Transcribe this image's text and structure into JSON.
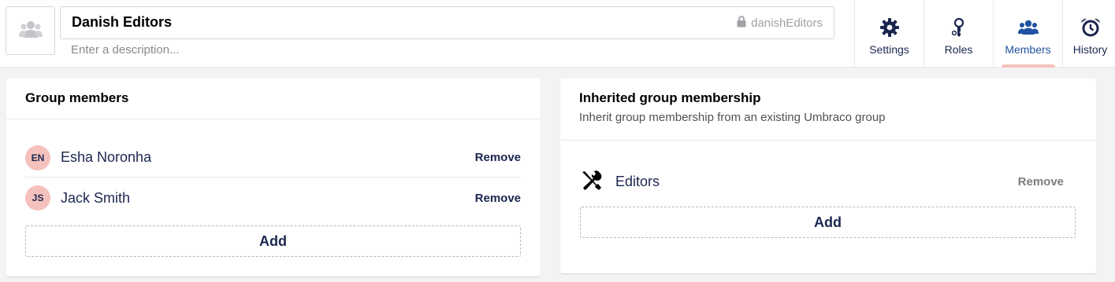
{
  "header": {
    "group_name": "Danish Editors",
    "alias": "danishEditors",
    "description_placeholder": "Enter a description...",
    "avatar_icon": "users-icon"
  },
  "tabs": [
    {
      "label": "Settings",
      "icon": "gear-icon",
      "active": false
    },
    {
      "label": "Roles",
      "icon": "key-icon",
      "active": false
    },
    {
      "label": "Members",
      "icon": "users-icon",
      "active": true
    },
    {
      "label": "History",
      "icon": "alarm-clock-icon",
      "active": false
    }
  ],
  "colors": {
    "accent": "#2152a3",
    "active_indicator": "#f5c1bc",
    "avatar_bg": "#f5c1bc",
    "text": "#1b264f"
  },
  "group_members": {
    "title": "Group members",
    "members": [
      {
        "initials": "EN",
        "name": "Esha Noronha",
        "remove_label": "Remove"
      },
      {
        "initials": "JS",
        "name": "Jack Smith",
        "remove_label": "Remove"
      }
    ],
    "add_label": "Add"
  },
  "inherited": {
    "title": "Inherited group membership",
    "subtitle": "Inherit group membership from an existing Umbraco group",
    "groups": [
      {
        "name": "Editors",
        "icon": "tools-icon",
        "remove_label": "Remove"
      }
    ],
    "add_label": "Add"
  }
}
